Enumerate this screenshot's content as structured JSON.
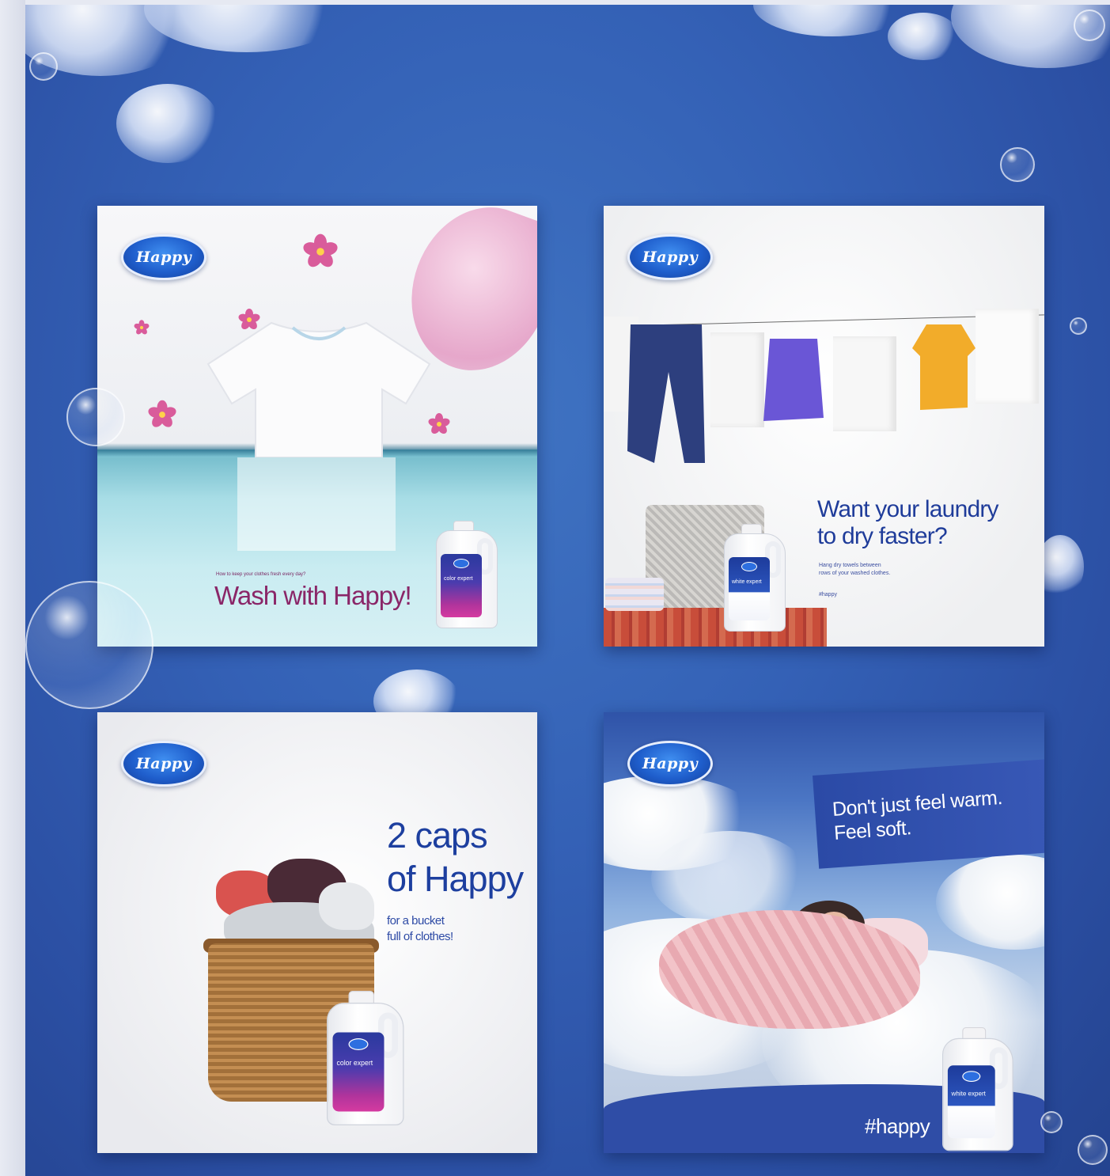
{
  "brand": {
    "logo_text": "Happy"
  },
  "card1": {
    "small_text": "How to keep your clothes fresh every day?",
    "headline": "Wash with Happy!",
    "bottle_label": "color expert"
  },
  "card2": {
    "headline_1": "Want your laundry",
    "headline_2": "to dry faster?",
    "sub_1": "Hang dry towels between",
    "sub_2": "rows of your washed clothes.",
    "hashtag": "#happy",
    "bottle_label": "white expert"
  },
  "card3": {
    "headline_1": "2 caps",
    "headline_2": "of Happy",
    "sub_1": "for a bucket",
    "sub_2": "full of clothes!",
    "bottle_label": "color expert"
  },
  "card4": {
    "headline_1": "Don't just feel warm.",
    "headline_2": "Feel soft.",
    "hashtag": "#happy",
    "bottle_label": "white expert"
  },
  "colors": {
    "background": "#3461b6",
    "brand_blue": "#1f3c9a",
    "magenta": "#8a2668"
  }
}
